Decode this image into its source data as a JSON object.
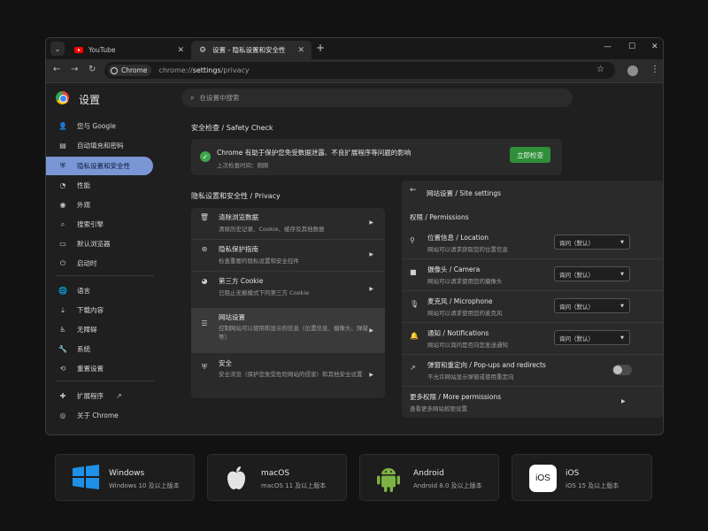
{
  "browser": {
    "tabs": [
      {
        "title": "YouTube",
        "icon": "youtube-icon"
      },
      {
        "title": "设置 - 隐私设置和安全性",
        "icon": "gear-icon"
      }
    ],
    "chip_label": "Chrome",
    "url_prefix": "chrome://",
    "url_bold": "settings",
    "url_suffix": "/privacy"
  },
  "sidebar": {
    "title": "设置",
    "items": [
      {
        "label": "您与 Google",
        "icon": "person-icon"
      },
      {
        "label": "自动填充和密码",
        "icon": "clipboard-icon"
      },
      {
        "label": "隐私设置和安全性",
        "icon": "shield-icon",
        "selected": true
      },
      {
        "label": "性能",
        "icon": "speedometer-icon"
      },
      {
        "label": "外观",
        "icon": "palette-icon"
      },
      {
        "label": "搜索引擎",
        "icon": "search-icon"
      },
      {
        "label": "默认浏览器",
        "icon": "browser-icon"
      },
      {
        "label": "启动时",
        "icon": "power-icon"
      },
      {
        "label": "语言",
        "icon": "globe-icon"
      },
      {
        "label": "下载内容",
        "icon": "download-icon"
      },
      {
        "label": "无障碍",
        "icon": "accessibility-icon"
      },
      {
        "label": "系统",
        "icon": "wrench-icon"
      },
      {
        "label": "重置设置",
        "icon": "reset-icon"
      },
      {
        "label": "扩展程序",
        "icon": "puzzle-icon"
      },
      {
        "label": "关于 Chrome",
        "icon": "chrome-icon"
      }
    ]
  },
  "search": {
    "placeholder": "在设置中搜索"
  },
  "safety_check": {
    "heading": "安全检查 / Safety Check",
    "message": "Chrome 有助于保护您免受数据泄露、不良扩展程序等问题的影响",
    "last_check": "上次检查时间：刚刚",
    "button": "立即检查"
  },
  "privacy": {
    "heading": "隐私设置和安全性 / Privacy",
    "rows": [
      {
        "title": "清除浏览数据",
        "subtitle": "清除历史记录、Cookie、缓存及其他数据",
        "icon": "trash-icon"
      },
      {
        "title": "隐私保护指南",
        "subtitle": "检查重要的隐私设置和安全控件",
        "icon": "privacy-guide-icon"
      },
      {
        "title": "第三方 Cookie",
        "subtitle": "已阻止无痕模式下的第三方 Cookie",
        "icon": "cookie-icon"
      },
      {
        "title": "网站设置",
        "subtitle": "控制网站可以使用和显示的信息（位置信息、摄像头、弹窗等）",
        "icon": "sliders-icon",
        "highlighted": true
      },
      {
        "title": "安全",
        "subtitle": "安全浏览（保护您免受危险网站的侵害）和其他安全设置",
        "icon": "shield-icon"
      }
    ]
  },
  "site_settings": {
    "title": "网站设置 / Site settings",
    "section": "权限 / Permissions",
    "rows": [
      {
        "title": "位置信息 / Location",
        "subtitle": "网站可以请求获取您的位置信息",
        "icon": "location-icon",
        "value": "询问（默认）"
      },
      {
        "title": "摄像头 / Camera",
        "subtitle": "网站可以请求使用您的摄像头",
        "icon": "camera-icon",
        "value": "询问（默认）"
      },
      {
        "title": "麦克风 / Microphone",
        "subtitle": "网站可以请求使用您的麦克风",
        "icon": "microphone-icon",
        "value": "询问（默认）"
      },
      {
        "title": "通知 / Notifications",
        "subtitle": "网站可以询问是否向您发送通知",
        "icon": "bell-icon",
        "value": "询问（默认）"
      }
    ],
    "popups": {
      "title": "弹窗和重定向 / Pop-ups and redirects",
      "subtitle": "不允许网站显示弹窗或使用重定向",
      "enabled": false
    },
    "more": {
      "title": "更多权限 / More permissions",
      "subtitle": "查看更多网站权限设置"
    }
  },
  "platforms": [
    {
      "name": "Windows",
      "version": "Windows 10 及以上版本",
      "icon": "windows-logo-icon"
    },
    {
      "name": "macOS",
      "version": "macOS 11 及以上版本",
      "icon": "apple-logo-icon"
    },
    {
      "name": "Android",
      "version": "Android 8.0 及以上版本",
      "icon": "android-logo-icon"
    },
    {
      "name": "iOS",
      "version": "iOS 15 及以上版本",
      "icon": "ios-logo-icon",
      "badge": "iOS"
    }
  ]
}
